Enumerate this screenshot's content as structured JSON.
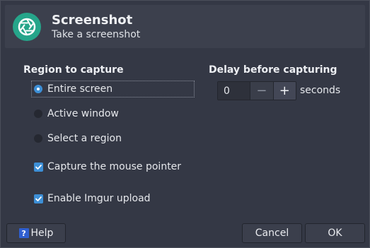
{
  "header": {
    "title": "Screenshot",
    "subtitle": "Take a screenshot",
    "icon": "camera-shutter-icon",
    "icon_color": "#26a58a"
  },
  "region": {
    "heading": "Region to capture",
    "options": [
      {
        "label": "Entire screen",
        "selected": true
      },
      {
        "label": "Active window",
        "selected": false
      },
      {
        "label": "Select a region",
        "selected": false
      }
    ]
  },
  "checkboxes": [
    {
      "label": "Capture the mouse pointer",
      "checked": true
    },
    {
      "label": "Enable Imgur upload",
      "checked": true
    }
  ],
  "delay": {
    "heading": "Delay before capturing",
    "value": "0",
    "minus": "−",
    "plus": "+",
    "unit": "seconds"
  },
  "buttons": {
    "help": "Help",
    "help_icon_glyph": "?",
    "cancel": "Cancel",
    "ok": "OK"
  },
  "colors": {
    "accent": "#3d8fd6",
    "background": "#343845",
    "header": "#3c404d"
  }
}
